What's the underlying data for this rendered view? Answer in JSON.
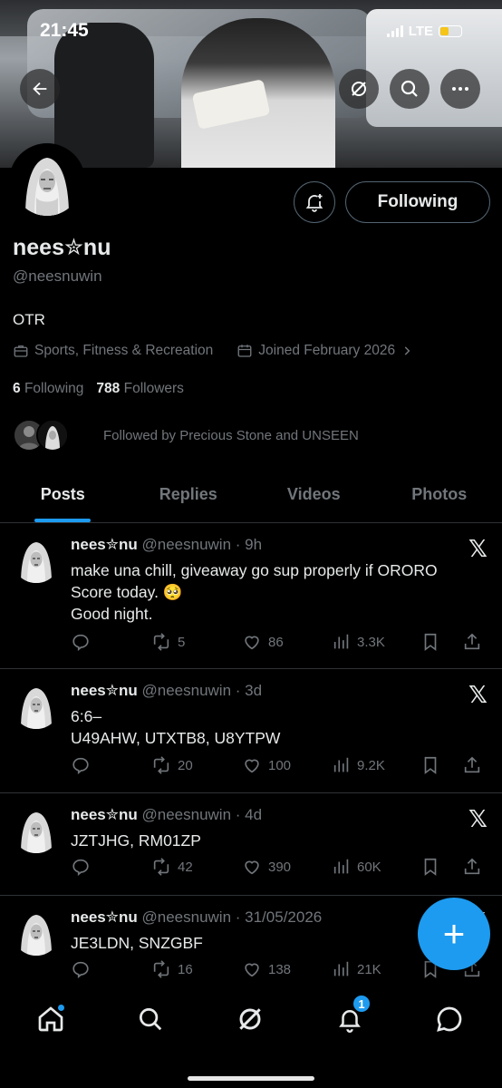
{
  "status_bar": {
    "time": "21:45",
    "network": "LTE"
  },
  "profile": {
    "display_name": "nees✮nu",
    "handle": "@neesnuwin",
    "bio": "OTR",
    "category": "Sports, Fitness & Recreation",
    "joined": "Joined February 2026",
    "following_count": "6",
    "following_label": "Following",
    "followers_count": "788",
    "followers_label": "Followers",
    "followed_by": "Followed by Precious Stone and UNSEEN",
    "follow_button": "Following"
  },
  "tabs": [
    {
      "label": "Posts",
      "active": true
    },
    {
      "label": "Replies",
      "active": false
    },
    {
      "label": "Videos",
      "active": false
    },
    {
      "label": "Photos",
      "active": false
    }
  ],
  "posts": [
    {
      "name": "nees✮nu",
      "meta": "@neesnuwin · 9h",
      "lines": [
        "make una chill, giveaway go sup properly if ORORO",
        "Score today. 🥺",
        "Good night."
      ],
      "reposts": "5",
      "likes": "86",
      "views": "3.3K"
    },
    {
      "name": "nees✮nu",
      "meta": "@neesnuwin · 3d",
      "lines": [
        "6:6–",
        "U49AHW, UTXTB8, U8YTPW"
      ],
      "reposts": "20",
      "likes": "100",
      "views": "9.2K"
    },
    {
      "name": "nees✮nu",
      "meta": "@neesnuwin · 4d",
      "lines": [
        "JZTJHG, RM01ZP"
      ],
      "reposts": "42",
      "likes": "390",
      "views": "60K"
    },
    {
      "name": "nees✮nu",
      "meta": "@neesnuwin · 31/05/2026",
      "lines": [
        "JE3LDN, SNZGBF"
      ],
      "reposts": "16",
      "likes": "138",
      "views": "21K"
    }
  ],
  "fab_label": "+",
  "notifications_badge": "1",
  "colors": {
    "accent": "#1d9bf0",
    "background": "#000000",
    "muted": "#71767b",
    "text": "#e7e9ea"
  }
}
